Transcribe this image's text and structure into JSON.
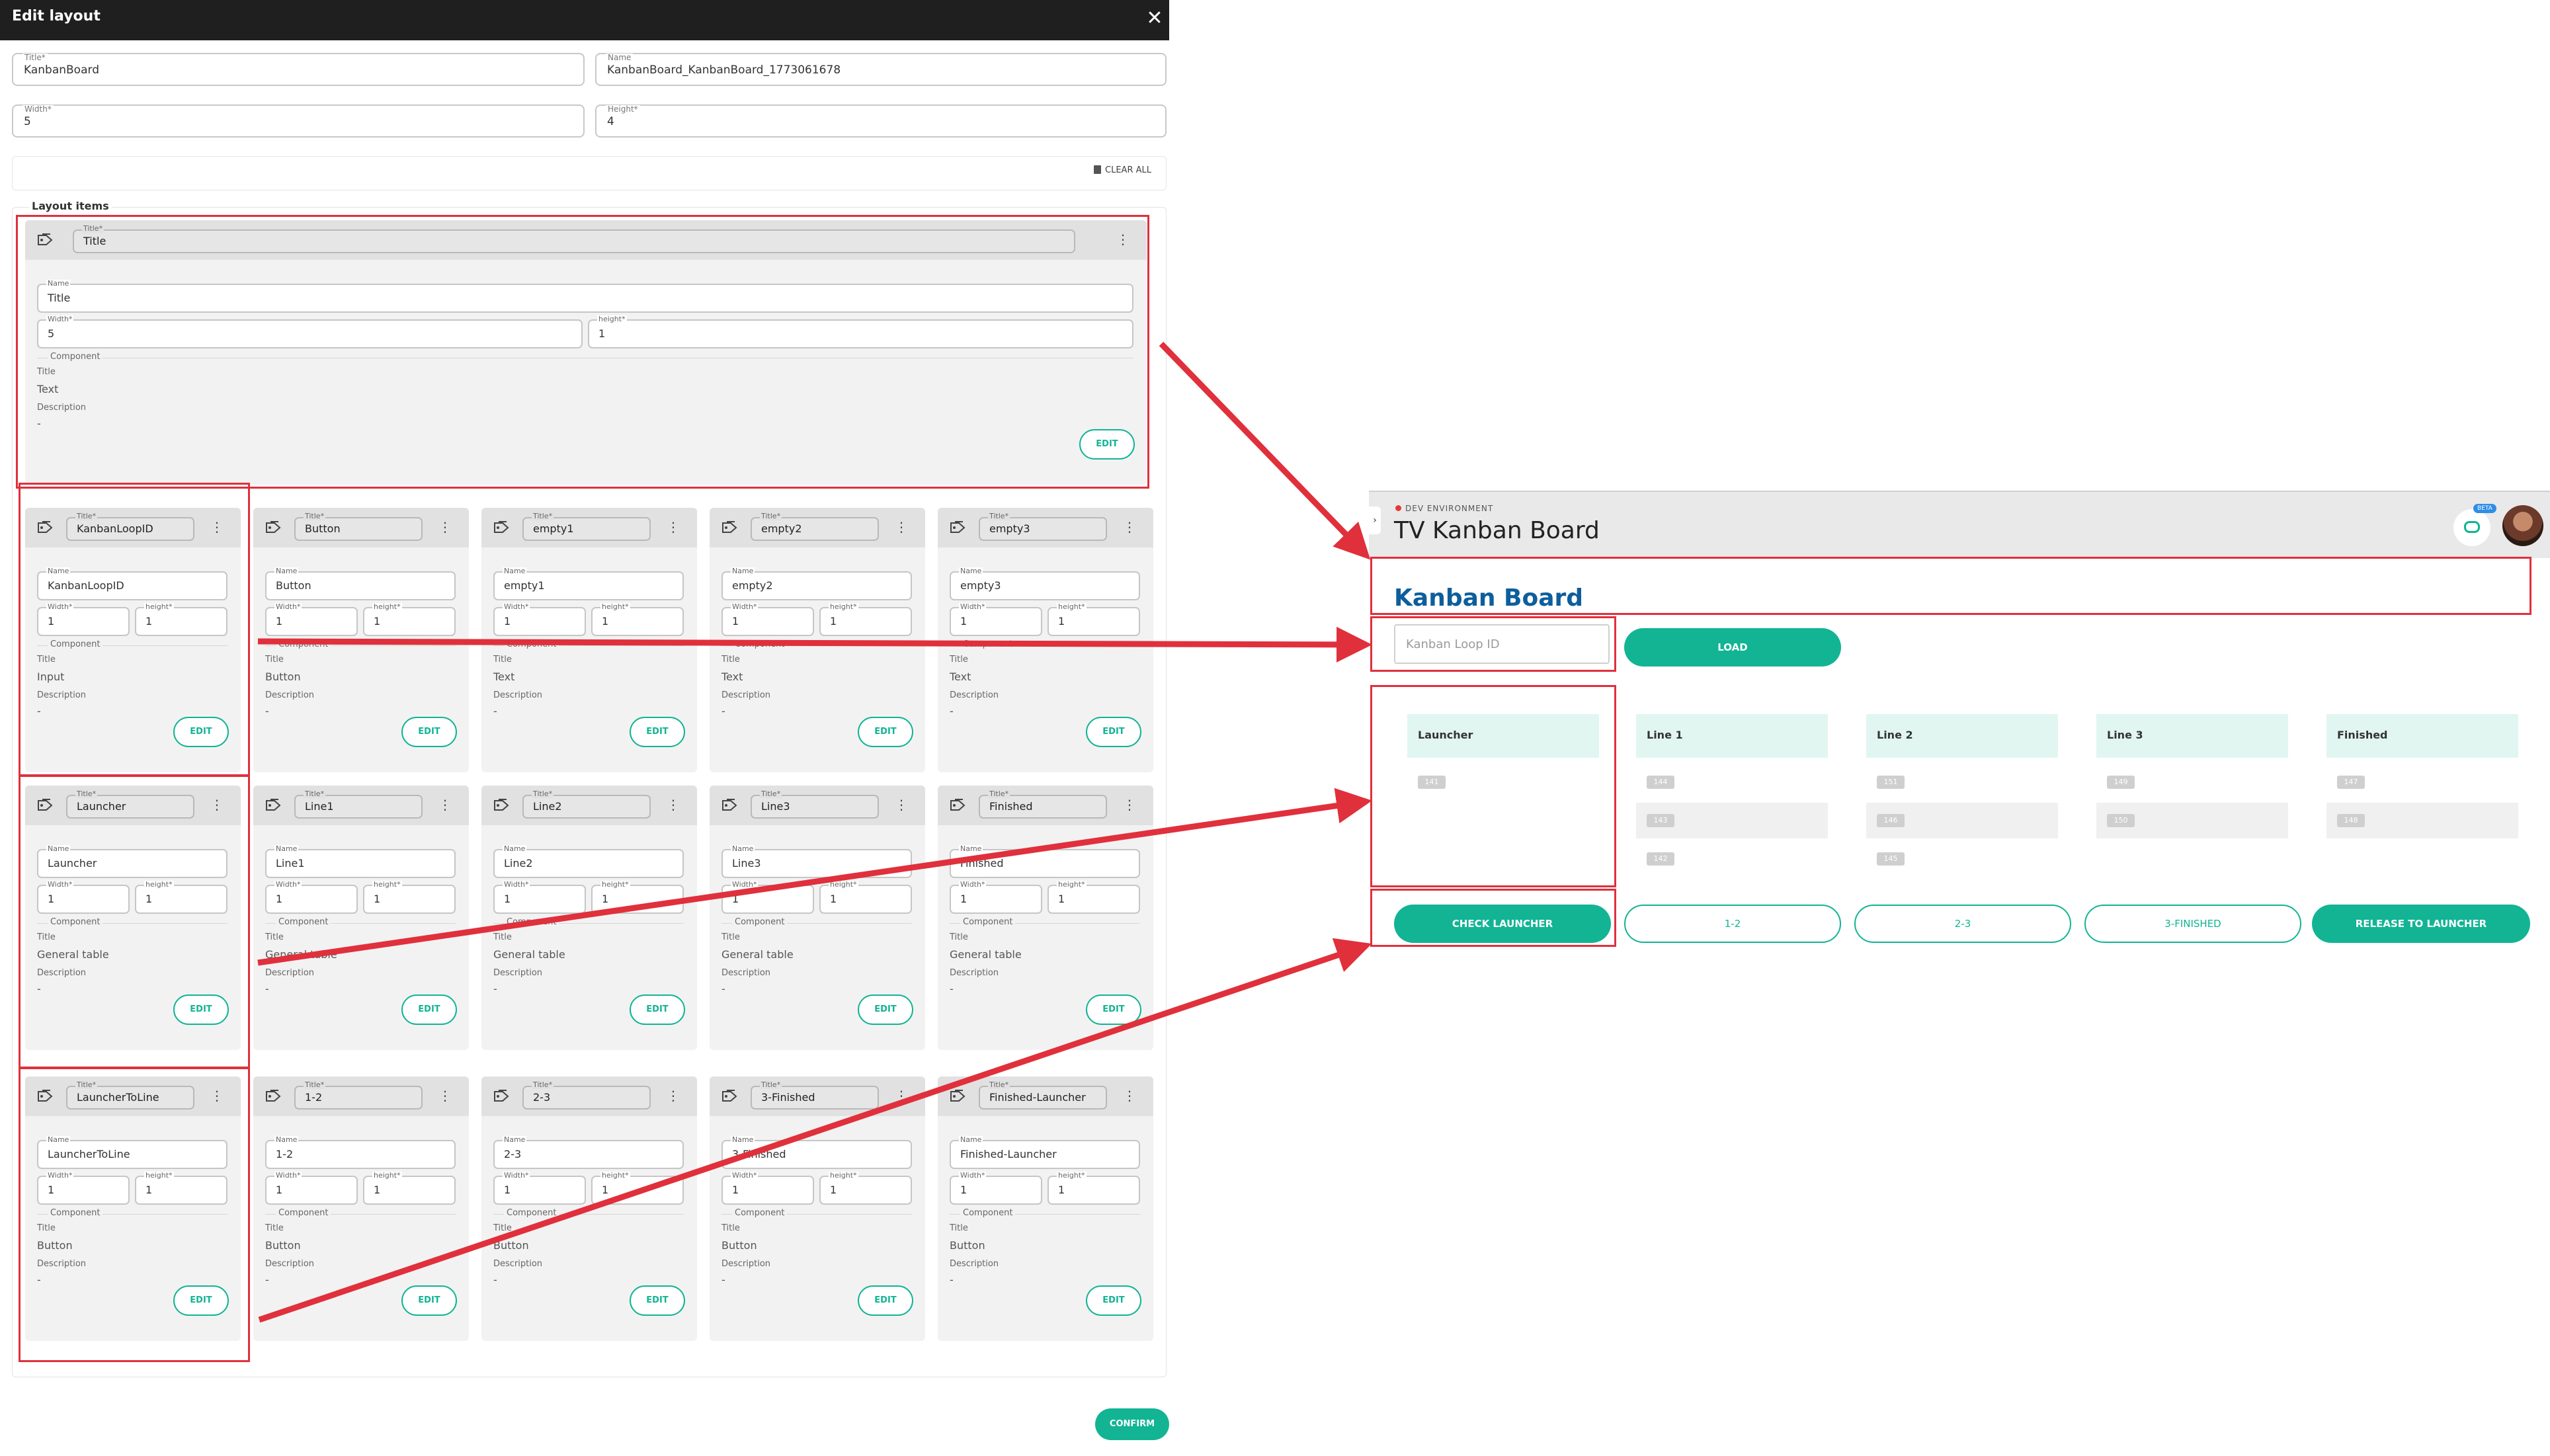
{
  "dialog": {
    "title": "Edit layout",
    "close_icon": "close-icon",
    "fields": {
      "title": {
        "label": "Title*",
        "value": "KanbanBoard"
      },
      "name": {
        "label": "Name",
        "value": "KanbanBoard_KanbanBoard_1773061678"
      },
      "width": {
        "label": "Width*",
        "value": "5"
      },
      "height": {
        "label": "Height*",
        "value": "4"
      }
    },
    "clear_all": "CLEAR ALL",
    "layout_items_label": "Layout items",
    "confirm": "CONFIRM",
    "labels": {
      "title": "Title*",
      "name": "Name",
      "width": "Width*",
      "height": "height*",
      "component": "Component",
      "comp_title": "Title",
      "description": "Description",
      "edit": "EDIT"
    },
    "items": [
      {
        "title": "Title",
        "name": "Title",
        "width": "5",
        "height": "1",
        "component": "Text",
        "description": "-"
      },
      {
        "title": "KanbanLoopID",
        "name": "KanbanLoopID",
        "width": "1",
        "height": "1",
        "component": "Input",
        "description": "-"
      },
      {
        "title": "Button",
        "name": "Button",
        "width": "1",
        "height": "1",
        "component": "Button",
        "description": "-"
      },
      {
        "title": "empty1",
        "name": "empty1",
        "width": "1",
        "height": "1",
        "component": "Text",
        "description": "-"
      },
      {
        "title": "empty2",
        "name": "empty2",
        "width": "1",
        "height": "1",
        "component": "Text",
        "description": "-"
      },
      {
        "title": "empty3",
        "name": "empty3",
        "width": "1",
        "height": "1",
        "component": "Text",
        "description": "-"
      },
      {
        "title": "Launcher",
        "name": "Launcher",
        "width": "1",
        "height": "1",
        "component": "General table",
        "description": "-"
      },
      {
        "title": "Line1",
        "name": "Line1",
        "width": "1",
        "height": "1",
        "component": "General table",
        "description": "-"
      },
      {
        "title": "Line2",
        "name": "Line2",
        "width": "1",
        "height": "1",
        "component": "General table",
        "description": "-"
      },
      {
        "title": "Line3",
        "name": "Line3",
        "width": "1",
        "height": "1",
        "component": "General table",
        "description": "-"
      },
      {
        "title": "Finished",
        "name": "Finished",
        "width": "1",
        "height": "1",
        "component": "General table",
        "description": "-"
      },
      {
        "title": "LauncherToLine",
        "name": "LauncherToLine",
        "width": "1",
        "height": "1",
        "component": "Button",
        "description": "-"
      },
      {
        "title": "1-2",
        "name": "1-2",
        "width": "1",
        "height": "1",
        "component": "Button",
        "description": "-"
      },
      {
        "title": "2-3",
        "name": "2-3",
        "width": "1",
        "height": "1",
        "component": "Button",
        "description": "-"
      },
      {
        "title": "3-Finished",
        "name": "3-Finished",
        "width": "1",
        "height": "1",
        "component": "Button",
        "description": "-"
      },
      {
        "title": "Finished-Launcher",
        "name": "Finished-Launcher",
        "width": "1",
        "height": "1",
        "component": "Button",
        "description": "-"
      }
    ]
  },
  "preview": {
    "environment": "DEV ENVIRONMENT",
    "app_title": "TV Kanban Board",
    "beta": "BETA",
    "kanban_title": "Kanban Board",
    "loop_input_placeholder": "Kanban Loop ID",
    "load": "LOAD",
    "columns": [
      {
        "name": "Launcher",
        "ids": [
          "141"
        ]
      },
      {
        "name": "Line 1",
        "ids": [
          "144",
          "143",
          "142"
        ]
      },
      {
        "name": "Line 2",
        "ids": [
          "151",
          "146",
          "145"
        ]
      },
      {
        "name": "Line 3",
        "ids": [
          "149",
          "150"
        ]
      },
      {
        "name": "Finished",
        "ids": [
          "147",
          "148"
        ]
      }
    ],
    "buttons": {
      "check_launcher": "CHECK LAUNCHER",
      "b12": "1-2",
      "b23": "2-3",
      "b3f": "3-FINISHED",
      "release": "RELEASE TO LAUNCHER"
    }
  },
  "colors": {
    "accent": "#12b494",
    "annotation": "#e0303c",
    "header_dark": "#1f1f1f",
    "title_blue": "#0e5e9c"
  },
  "icons": [
    "close-icon",
    "tag-icon",
    "more-vert-icon",
    "trash-icon",
    "chevron-right-icon",
    "chat-icon",
    "avatar"
  ]
}
